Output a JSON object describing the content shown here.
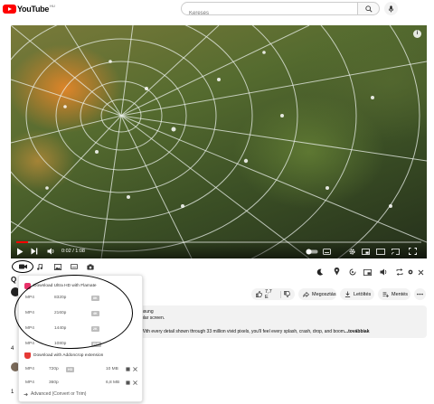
{
  "masthead": {
    "logo_text": "YouTube",
    "region": "HU",
    "search_placeholder": "Keresés",
    "icons": [
      "search-icon",
      "mic-icon"
    ]
  },
  "player": {
    "time": "0:02 / 1:08",
    "progress_fraction": 0.03,
    "info": "i"
  },
  "video": {
    "title_visible": "Q",
    "likes": "7,7 E",
    "share_label": "Megosztás",
    "download_label": "Letöltés",
    "save_label": "Mentés",
    "desc_line1": "nsung",
    "desc_line2": "ular screen.",
    "desc_line3": "With every detail shown through 33 million vivid pixels, you'll feel every splash, crash, drop, and boom",
    "desc_more": "...továbbiak"
  },
  "side": {
    "left_count": "4",
    "left_item": "1"
  },
  "popup": {
    "section1_title": "Download Ultra HD with Flamate",
    "hd_formats": [
      {
        "format": "MP4",
        "quality": "8320p",
        "badge": "8K"
      },
      {
        "format": "MP4",
        "quality": "2160p",
        "badge": "4K"
      },
      {
        "format": "MP4",
        "quality": "1440p",
        "badge": "2K"
      },
      {
        "format": "MP4",
        "quality": "1080p",
        "badge": "FHD"
      }
    ],
    "section2_title": "Download with Addoncrop extension",
    "ext_formats": [
      {
        "format": "MP4",
        "quality": "720p",
        "badge": "HD",
        "size": "10 MB"
      },
      {
        "format": "MP4",
        "quality": "360p",
        "badge": "",
        "size": "6,8 MB"
      }
    ],
    "advanced_label": "Advanced (Convert or Trim)"
  },
  "colors": {
    "brand_red": "#ff0000",
    "progress_red": "#ff0000",
    "flamate_pink": "#e8326a",
    "addoncrop_red": "#e53935",
    "pill_bg": "#f2f2f2"
  }
}
